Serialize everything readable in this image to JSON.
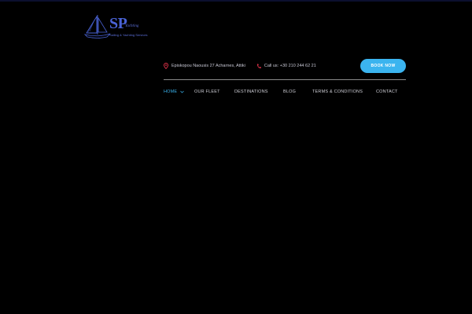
{
  "brand": {
    "logo_letters": "SP",
    "logo_sub": "Yachting",
    "tagline": "Sailing & Yachting Services",
    "accent_color": "#4a63d6"
  },
  "header": {
    "address": "Episkopou Naousis 27 Acharnes, Attiki",
    "phone": "Call us: +30 210 244 62 21",
    "book_label": "BOOK NOW",
    "book_color": "#3bb4ef",
    "icon_color": "#e5334b"
  },
  "nav": {
    "items": [
      {
        "label": "HOME",
        "active": true,
        "has_dropdown": true
      },
      {
        "label": "OUR FLEET",
        "active": false
      },
      {
        "label": "DESTINATIONS",
        "active": false
      },
      {
        "label": "BLOG",
        "active": false
      },
      {
        "label": "TERMS & CONDITIONS",
        "active": false
      },
      {
        "label": "CONTACT",
        "active": false
      }
    ]
  }
}
